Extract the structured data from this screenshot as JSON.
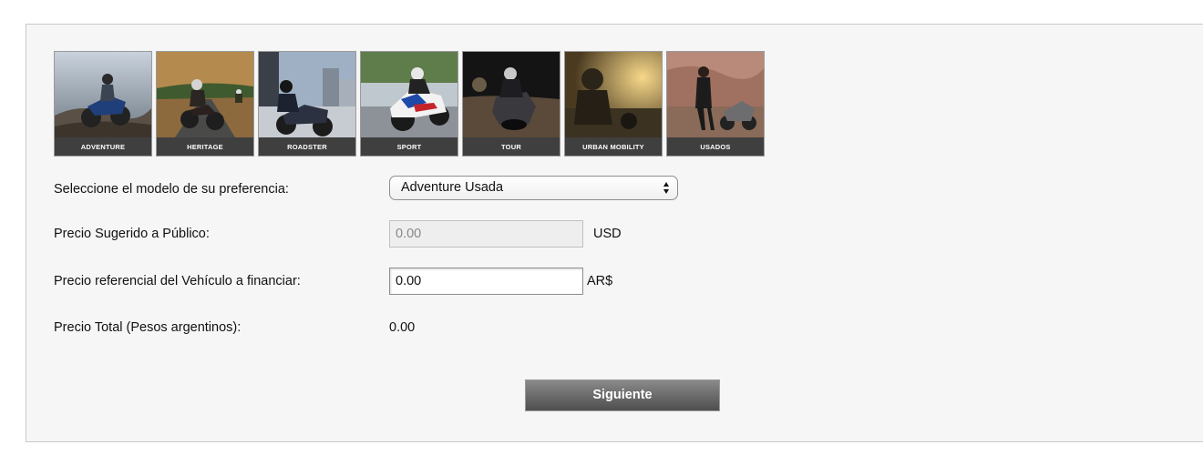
{
  "categories": [
    {
      "label": "ADVENTURE"
    },
    {
      "label": "HERITAGE"
    },
    {
      "label": "ROADSTER"
    },
    {
      "label": "SPORT"
    },
    {
      "label": "TOUR"
    },
    {
      "label": "URBAN MOBILITY"
    },
    {
      "label": "USADOS"
    }
  ],
  "form": {
    "model_label": "Seleccione el modelo de su preferencia:",
    "model_value": "Adventure Usada",
    "suggested_price_label": "Precio Sugerido a Público:",
    "suggested_price_value": "0.00",
    "suggested_price_unit": "USD",
    "reference_price_label": "Precio referencial del Vehículo a financiar:",
    "reference_price_value": "0.00",
    "reference_price_unit": "AR$",
    "total_label": "Precio Total (Pesos argentinos):",
    "total_value": "0.00"
  },
  "next_button": "Siguiente",
  "colors": {
    "panel_bg": "#f6f6f6",
    "caption_bg": "#3f3f3f",
    "button_top": "#8a8a8a",
    "button_bottom": "#4e4e4e"
  }
}
